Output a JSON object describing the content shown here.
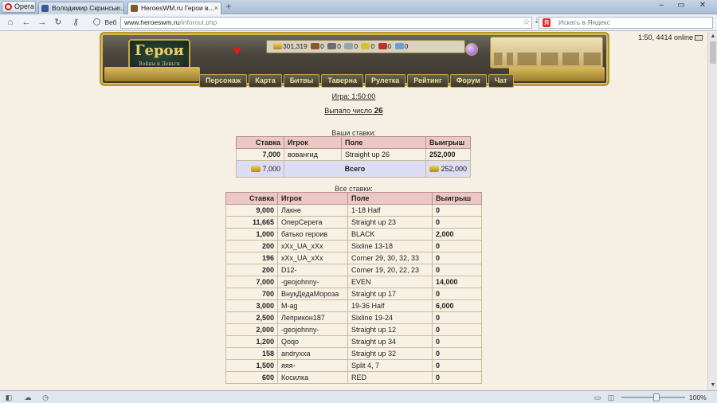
{
  "browser": {
    "menu_label": "Opera",
    "tabs": [
      {
        "title": "Володимир Скринськ...",
        "favicon_color": "#3b5998"
      },
      {
        "title": "HeroesWM.ru Герои в...",
        "favicon_color": "#7a5a2a"
      }
    ],
    "web_label": "Веб",
    "url_host": "www.heroeswm.ru",
    "url_path": "/inforoul.php",
    "search_placeholder": "Искать в Яндекс"
  },
  "site": {
    "logo_title": "Герои",
    "logo_subtitle": "Войны и Деньги",
    "online_text": "1:50, 4414 online",
    "resources": {
      "gold": "301,319",
      "wood": "0",
      "ore": "0",
      "mercury": "0",
      "sulfur": "0",
      "crystals": "0",
      "gems": "0"
    },
    "menu": [
      "Персонаж",
      "Карта",
      "Битвы",
      "Таверна",
      "Рулетка",
      "Рейтинг",
      "Форум",
      "Чат"
    ]
  },
  "roulette": {
    "game_label": "Игра: 1:50:00",
    "drawn_label": "Выпало число",
    "drawn_number": "26",
    "my_bets_caption": "Ваши ставки:",
    "all_bets_caption": "Все ставки:",
    "headers": [
      "Ставка",
      "Игрок",
      "Поле",
      "Выигрыш"
    ],
    "my_bets": [
      {
        "stake": "7,000",
        "player": "вовангид",
        "field": "Straight up 26",
        "win": "252,000"
      }
    ],
    "my_total": {
      "stake": "7,000",
      "label": "Всего",
      "win": "252,000"
    },
    "all_bets": [
      {
        "stake": "9,000",
        "player": "Лакне",
        "field": "1-18 Half",
        "win": "0"
      },
      {
        "stake": "11,665",
        "player": "ОперСерега",
        "field": "Straight up 23",
        "win": "0"
      },
      {
        "stake": "1,000",
        "player": "батько героив",
        "field": "BLACK",
        "win": "2,000"
      },
      {
        "stake": "200",
        "player": "xXx_UA_xXx",
        "field": "Sixline 13-18",
        "win": "0"
      },
      {
        "stake": "196",
        "player": "xXx_UA_xXx",
        "field": "Corner 29, 30, 32, 33",
        "win": "0"
      },
      {
        "stake": "200",
        "player": "D12-",
        "field": "Corner 19, 20, 22, 23",
        "win": "0"
      },
      {
        "stake": "7,000",
        "player": "-geojohnny-",
        "field": "EVEN",
        "win": "14,000"
      },
      {
        "stake": "700",
        "player": "ВнукДедаМороза",
        "field": "Straight up 17",
        "win": "0"
      },
      {
        "stake": "3,000",
        "player": "M-ag",
        "field": "19-36 Half",
        "win": "6,000"
      },
      {
        "stake": "2,500",
        "player": "Леприкон187",
        "field": "Sixline 19-24",
        "win": "0"
      },
      {
        "stake": "2,000",
        "player": "-geojohnny-",
        "field": "Straight up 12",
        "win": "0"
      },
      {
        "stake": "1,200",
        "player": "Qoqo",
        "field": "Straight up 34",
        "win": "0"
      },
      {
        "stake": "158",
        "player": "andryxxa",
        "field": "Straight up 32",
        "win": "0"
      },
      {
        "stake": "1,500",
        "player": "яяя-",
        "field": "Split 4, 7",
        "win": "0"
      },
      {
        "stake": "600",
        "player": "Косилка",
        "field": "RED",
        "win": "0"
      }
    ]
  },
  "statusbar": {
    "zoom": "100%"
  }
}
